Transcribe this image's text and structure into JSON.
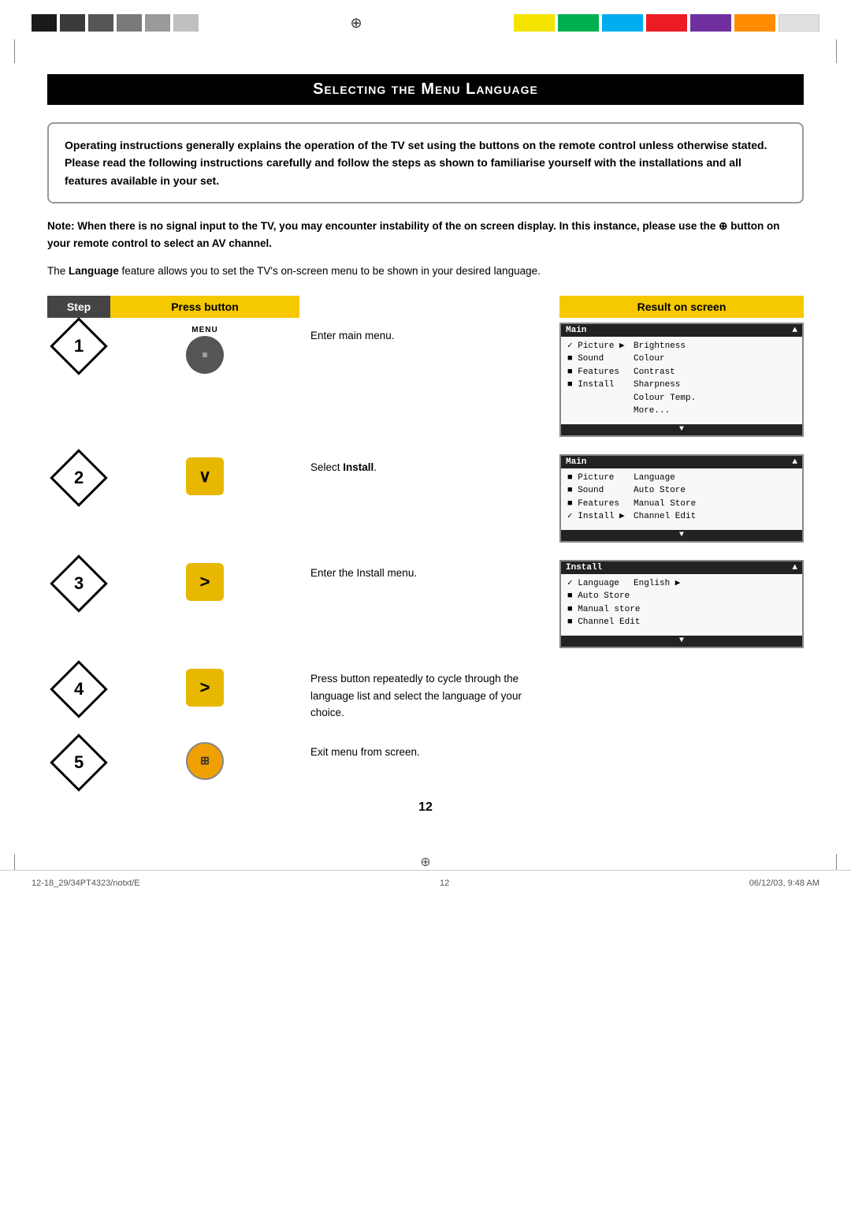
{
  "page": {
    "title": "Selecting the Menu Language",
    "number": "12"
  },
  "top_colors_bw": [
    "#1a1a1a",
    "#3a3a3a",
    "#5a5a5a",
    "#7a7a7a",
    "#9a9a9a",
    "#b8b8b8"
  ],
  "top_colors_rgb": [
    "#f5e300",
    "#00b050",
    "#00aeef",
    "#ed1c24",
    "#7030a0",
    "#ff6600",
    "#ffffff"
  ],
  "intro_text": "Operating instructions generally explains the operation of the TV set using the buttons on the remote control unless otherwise stated. Please read the following instructions carefully and follow the steps as shown to familiarise yourself with the installations and all features available in your set.",
  "note_text": "Note: When there is no signal input to the TV, you may encounter instability of the on screen display. In this instance, please use the  button on your remote control to select an AV channel.",
  "lang_text": "The Language feature allows you to set the TV's on-screen menu to be shown in your desired language.",
  "header": {
    "step_label": "Step",
    "button_label": "Press button",
    "result_label": "Result on screen"
  },
  "steps": [
    {
      "number": "1",
      "btn_type": "menu",
      "btn_label": "MENU",
      "description": "Enter main menu.",
      "screen": {
        "title": "Main",
        "rows": [
          {
            "left": "✓ Picture",
            "right": "Brightness",
            "selected": true
          },
          {
            "left": "■ Sound",
            "right": "Colour"
          },
          {
            "left": "■ Features",
            "right": "Contrast"
          },
          {
            "left": "■ Install",
            "right": "Sharpness"
          },
          {
            "left": "",
            "right": "Colour Temp."
          },
          {
            "left": "",
            "right": "More..."
          }
        ]
      }
    },
    {
      "number": "2",
      "btn_type": "down",
      "btn_label": "",
      "description": "Select Install.",
      "description_bold": "Install",
      "screen": {
        "title": "Main",
        "rows": [
          {
            "left": "■ Picture",
            "right": "Language"
          },
          {
            "left": "■ Sound",
            "right": "Auto Store"
          },
          {
            "left": "■ Features",
            "right": "Manual Store"
          },
          {
            "left": "✓ Install",
            "right": "Channel Edit",
            "selected": true
          }
        ]
      }
    },
    {
      "number": "3",
      "btn_type": "right",
      "btn_label": "",
      "description": "Enter the Install menu.",
      "screen": {
        "title": "Install",
        "rows": [
          {
            "left": "✓ Language",
            "right": "English",
            "selected": true
          },
          {
            "left": "■ Auto Store",
            "right": ""
          },
          {
            "left": "■ Manual store",
            "right": ""
          },
          {
            "left": "■ Channel Edit",
            "right": ""
          }
        ],
        "shared_with_4": true
      }
    },
    {
      "number": "4",
      "btn_type": "right",
      "btn_label": "",
      "description": "Press button repeatedly to cycle through the language list and select the language of your choice.",
      "screen": null
    },
    {
      "number": "5",
      "btn_type": "exit",
      "btn_label": "",
      "description": "Exit menu from screen.",
      "screen": null
    }
  ],
  "footer": {
    "left": "12-18_29/34PT4323/notxt/E",
    "center": "12",
    "right": "06/12/03, 9:48 AM"
  }
}
